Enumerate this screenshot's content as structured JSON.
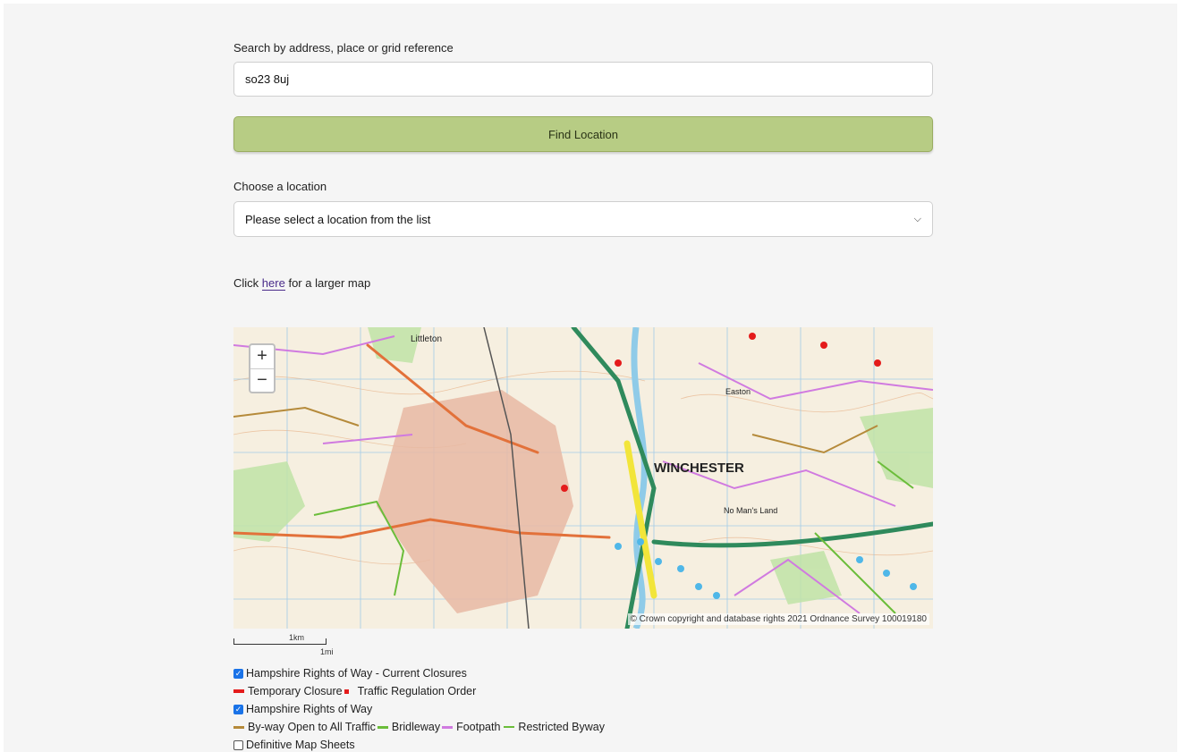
{
  "search": {
    "label": "Search by address, place or grid reference",
    "value": "so23 8uj",
    "button_label": "Find Location"
  },
  "location": {
    "label": "Choose a location",
    "selected": "Please select a location from the list"
  },
  "larger_map": {
    "prefix": "Click",
    "link": "here",
    "suffix": "for a larger map"
  },
  "map": {
    "zoom_in": "+",
    "zoom_out": "−",
    "copyright": "© Crown copyright and database rights 2021 Ordnance Survey 100019180",
    "scale_km": "1km",
    "scale_mi": "1mi",
    "place_labels": [
      "Littleton",
      "WINCHESTER",
      "Easton",
      "No Man's Land"
    ]
  },
  "layers": {
    "closures": {
      "label": "Hampshire Rights of Way - Current Closures",
      "checked": true,
      "legend": [
        "Temporary Closure",
        "Traffic Regulation Order"
      ]
    },
    "rights_of_way": {
      "label": "Hampshire Rights of Way",
      "checked": true,
      "legend": [
        "By-way Open to All Traffic",
        "Bridleway",
        "Footpath",
        "Restricted Byway"
      ]
    },
    "map_sheets": {
      "label": "Definitive Map Sheets",
      "checked": false
    }
  },
  "colors": {
    "find_button": "#b7cc84",
    "temporary_closure": "#e41b1b",
    "byway": "#b58a3a",
    "bridleway": "#6bbd3a",
    "footpath": "#d07ae0",
    "restricted_byway": "#6bbd3a"
  }
}
